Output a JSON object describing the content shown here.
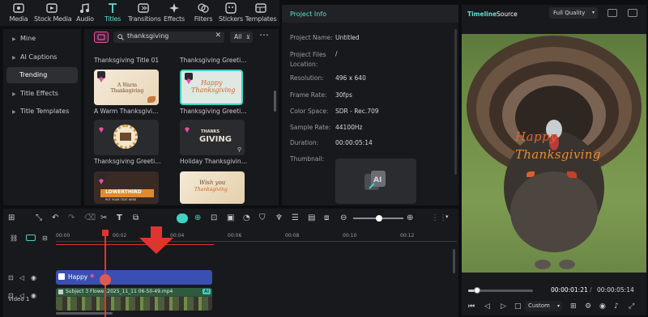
{
  "toolbar": {
    "items": [
      {
        "label": "Media",
        "icon": "media-icon"
      },
      {
        "label": "Stock Media",
        "icon": "stock-media-icon"
      },
      {
        "label": "Audio",
        "icon": "audio-icon"
      },
      {
        "label": "Titles",
        "icon": "titles-icon",
        "active": true
      },
      {
        "label": "Transitions",
        "icon": "transitions-icon"
      },
      {
        "label": "Effects",
        "icon": "effects-icon"
      },
      {
        "label": "Filters",
        "icon": "filters-icon"
      },
      {
        "label": "Stickers",
        "icon": "stickers-icon"
      },
      {
        "label": "Templates",
        "icon": "templates-icon"
      }
    ]
  },
  "sidebar": {
    "items": [
      {
        "label": "Mine"
      },
      {
        "label": "AI Captions"
      },
      {
        "label": "Trending",
        "selected": true
      },
      {
        "label": "Title Effects"
      },
      {
        "label": "Title Templates"
      }
    ]
  },
  "library": {
    "search_value": "thanksgiving",
    "filter_label": "All",
    "cards": [
      {
        "label": "Thanksgiving Title 01"
      },
      {
        "label": "Thanksgiving Greeting..."
      },
      {
        "label": "A Warm Thanksgiving ..."
      },
      {
        "label": "Thanksgiving Greeting..."
      },
      {
        "label": "Thanksgiving Greeting..."
      },
      {
        "label": "Holiday Thanksgiving ..."
      },
      {
        "label": "LOWERTHIRD"
      },
      {
        "label": "Wish you Thanksgiving"
      }
    ],
    "card_texts": {
      "warm": "A Warm Thanksgiving",
      "happy_line1": "Happy",
      "happy_line2": "Thanksgiving",
      "thanks": "THANKS",
      "giving": "GIVING",
      "lower": "LOWERTHIRD",
      "lower_sub": "PUT YOUR TEXT HERE",
      "wish1": "Wish you",
      "wish2": "Thanksgiving"
    }
  },
  "info": {
    "title": "Project Info",
    "rows": [
      {
        "key": "Project Name:",
        "value": "Untitled"
      },
      {
        "key": "Project Files Location:",
        "value": "/"
      },
      {
        "key": "Resolution:",
        "value": "496 x 640"
      },
      {
        "key": "Frame Rate:",
        "value": "30fps"
      },
      {
        "key": "Color Space:",
        "value": "SDR - Rec.709"
      },
      {
        "key": "Sample Rate:",
        "value": "44100Hz"
      },
      {
        "key": "Duration:",
        "value": "00:00:05:14"
      },
      {
        "key": "Thumbnail:",
        "value": ""
      }
    ]
  },
  "preview": {
    "tab_timeline": "Timeline",
    "tab_source": "Source",
    "quality": "Full Quality",
    "overlay_happy": "Happy",
    "overlay_thanks": "Thanksgiving",
    "current_time": "00:00:01:21",
    "total_time": "00:00:05:14",
    "zoom": "Custom",
    "progress": 0.14
  },
  "timeline": {
    "ruler": [
      "00:00",
      "00:02",
      "00:04",
      "00:06",
      "00:08",
      "00:10",
      "00:12"
    ],
    "title_clip": "Happy",
    "video_clip": "Subject 3 Flowe..2025_11_11 06-50-49.mp4",
    "ai_badge": "AI",
    "track_label": "Video 1",
    "playhead_time_fraction": 0.2
  },
  "colors": {
    "accent": "#3fd2c4",
    "playhead": "#e0342f",
    "title_clip": "#3a4fb3",
    "video_clip": "#2d4a37",
    "pink": "#e94fa0"
  }
}
